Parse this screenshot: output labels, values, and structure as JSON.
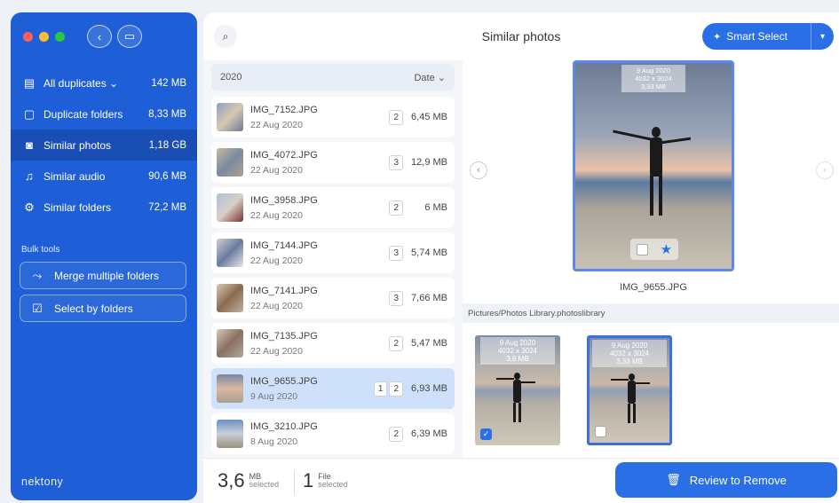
{
  "window": {
    "title": "Similar photos"
  },
  "sidebar": {
    "items": [
      {
        "label": "All duplicates ⌄",
        "size": "142 MB",
        "icon": "document-icon"
      },
      {
        "label": "Duplicate folders",
        "size": "8,33 MB",
        "icon": "folder-icon"
      },
      {
        "label": "Similar photos",
        "size": "1,18 GB",
        "icon": "camera-icon"
      },
      {
        "label": "Similar audio",
        "size": "90,6 MB",
        "icon": "music-note-icon"
      },
      {
        "label": "Similar folders",
        "size": "72,2 MB",
        "icon": "gear-folder-icon"
      }
    ],
    "bulk_title": "Bulk tools",
    "bulk": [
      {
        "label": "Merge multiple folders",
        "icon": "merge-arrow-icon"
      },
      {
        "label": "Select by folders",
        "icon": "folder-check-icon"
      }
    ],
    "brand": "nektony"
  },
  "toolbar": {
    "smart_select": "Smart Select"
  },
  "list": {
    "year": "2020",
    "sort": "Date ⌄",
    "rows": [
      {
        "name": "IMG_7152.JPG",
        "date": "22 Aug 2020",
        "count": "2",
        "size": "6,45 MB"
      },
      {
        "name": "IMG_4072.JPG",
        "date": "22 Aug 2020",
        "count": "3",
        "size": "12,9 MB"
      },
      {
        "name": "IMG_3958.JPG",
        "date": "22 Aug 2020",
        "count": "2",
        "size": "6 MB"
      },
      {
        "name": "IMG_7144.JPG",
        "date": "22 Aug 2020",
        "count": "3",
        "size": "5,74 MB"
      },
      {
        "name": "IMG_7141.JPG",
        "date": "22 Aug 2020",
        "count": "3",
        "size": "7,66 MB"
      },
      {
        "name": "IMG_7135.JPG",
        "date": "22 Aug 2020",
        "count": "2",
        "size": "5,47 MB"
      },
      {
        "name": "IMG_9655.JPG",
        "date": "9 Aug 2020",
        "count": "2",
        "size": "6,93 MB",
        "badge": "1"
      },
      {
        "name": "IMG_3210.JPG",
        "date": "8 Aug 2020",
        "count": "2",
        "size": "6,39 MB"
      }
    ]
  },
  "preview": {
    "info_date": "9 Aug 2020",
    "info_dims": "4032 x 3024",
    "info_size": "3,33 MB",
    "filename": "IMG_9655.JPG",
    "path": "Pictures/Photos Library.photoslibrary",
    "group": [
      {
        "date": "9 Aug 2020",
        "dims": "4032 x 3024",
        "size": "3,6 MB"
      },
      {
        "date": "9 Aug 2020",
        "dims": "4032 x 3024",
        "size": "3,33 MB"
      }
    ]
  },
  "footer": {
    "size_num": "3,6",
    "size_unit": "MB",
    "size_sub": "selected",
    "files_num": "1",
    "files_unit": "File",
    "files_sub": "selected",
    "review": "Review to Remove"
  }
}
